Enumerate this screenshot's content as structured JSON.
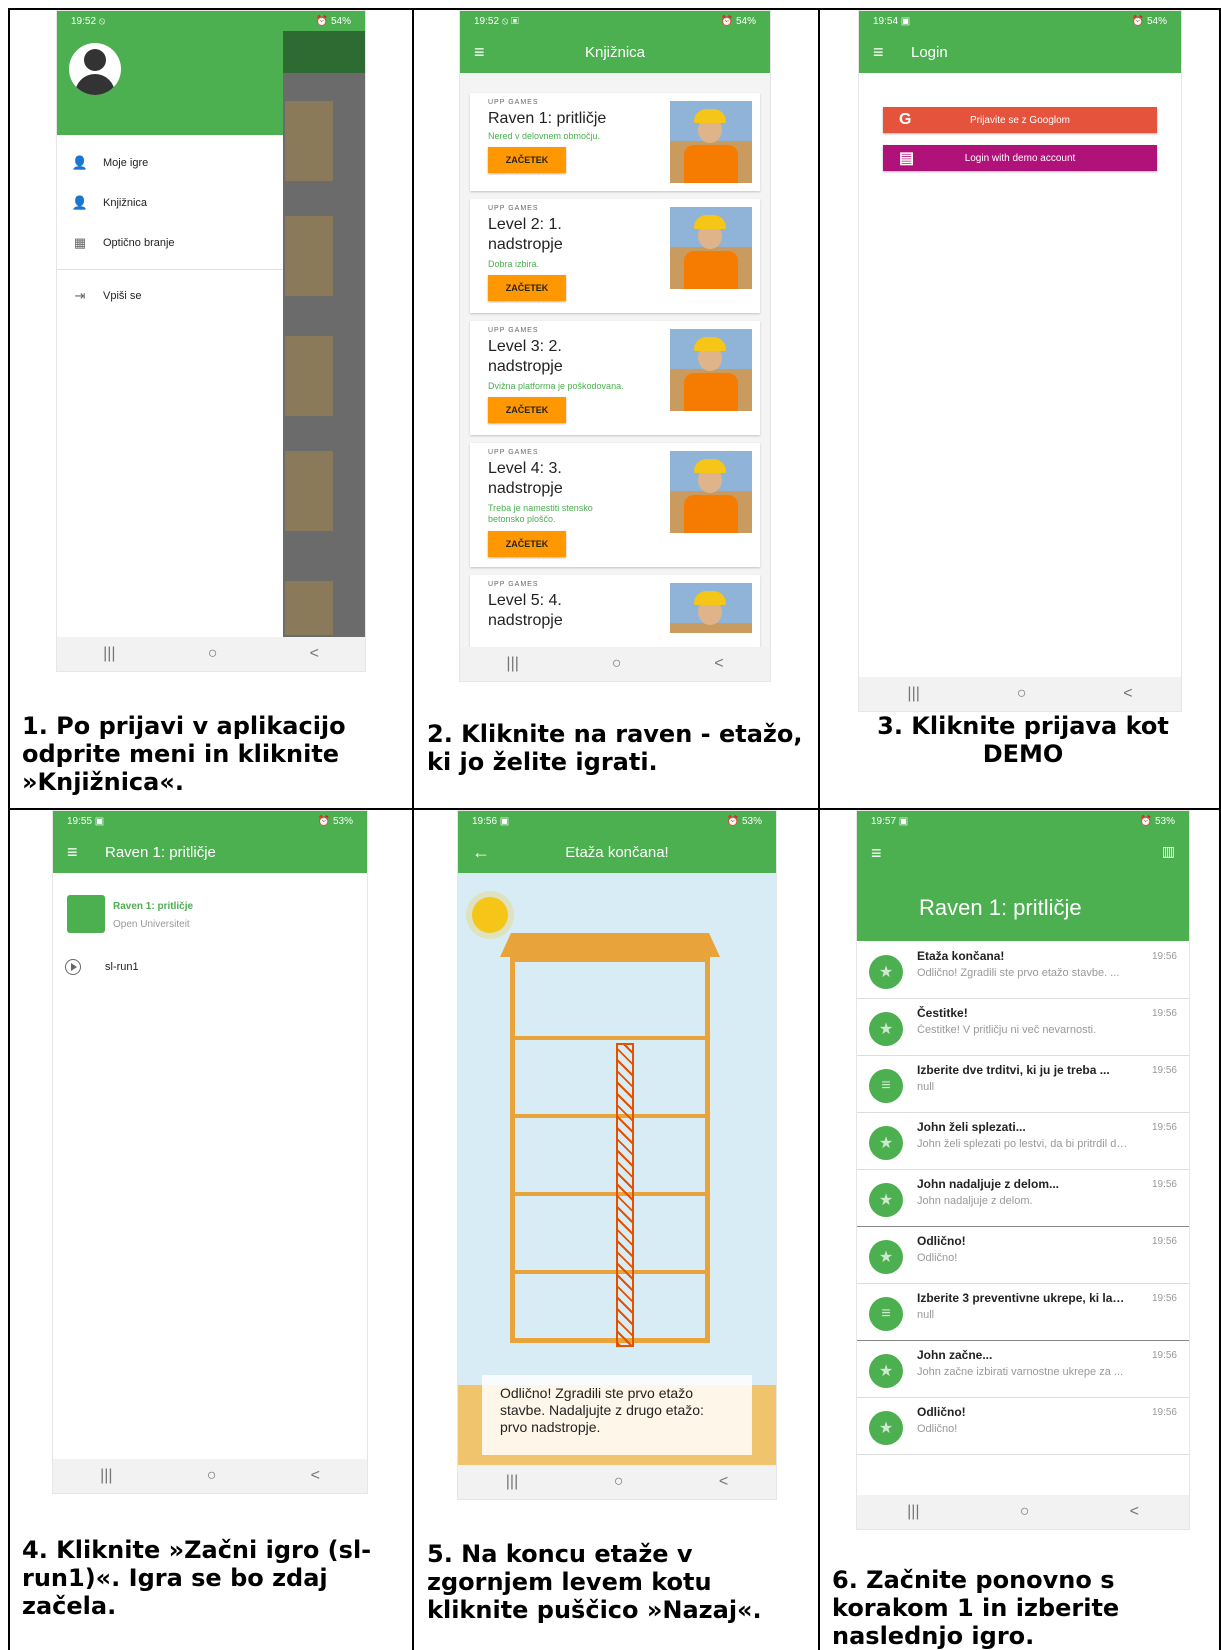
{
  "status": {
    "p1": {
      "time": "19:52 ⦸",
      "right": "⏰ 54%"
    },
    "p2": {
      "time": "19:52 ⦸ ▣",
      "right": "⏰ 54%"
    },
    "p3": {
      "time": "19:54 ▣",
      "right": "⏰ 54%"
    },
    "p4": {
      "time": "19:55 ▣",
      "right": "⏰ 53%"
    },
    "p5": {
      "time": "19:56 ▣",
      "right": "⏰ 53%"
    },
    "p6": {
      "time": "19:57 ▣",
      "right": "⏰ 53%"
    }
  },
  "nav": {
    "recent": "|||",
    "home": "○",
    "back": "<"
  },
  "icons": {
    "menu": "≡",
    "back_arrow": "←",
    "map": "▥",
    "person": "👤",
    "qr": "▦",
    "login": "⇥",
    "star": "★",
    "list": "≡"
  },
  "phone1": {
    "menu": [
      {
        "label": "Moje igre"
      },
      {
        "label": "Knjižnica"
      },
      {
        "label": "Optično branje"
      },
      {
        "label": "Vpiši se"
      }
    ]
  },
  "phone2": {
    "title": "Knjižnica",
    "cards": [
      {
        "brand": "UPP GAMES",
        "name": "Raven 1: pritličje",
        "desc": "Nered v delovnem območju.",
        "button": "ZAČETEK"
      },
      {
        "brand": "UPP GAMES",
        "name": "Level 2: 1. nadstropje",
        "desc": "Dobra izbira.",
        "button": "ZAČETEK"
      },
      {
        "brand": "UPP GAMES",
        "name": "Level 3: 2. nadstropje",
        "desc": "Dvižna platforma je poškodovana.",
        "button": "ZAČETEK"
      },
      {
        "brand": "UPP GAMES",
        "name": "Level 4: 3. nadstropje",
        "desc": "Treba je namestiti stensko betonsko ploščo.",
        "button": "ZAČETEK"
      },
      {
        "brand": "UPP GAMES",
        "name": "Level 5: 4. nadstropje",
        "desc": "",
        "button": ""
      }
    ]
  },
  "phone3": {
    "title": "Login",
    "google_btn": "Prijavite se z Googlom",
    "google_icon": "G",
    "demo_btn": "Login with demo account",
    "demo_icon": "▤"
  },
  "phone4": {
    "title": "Raven 1: pritličje",
    "game_title": "Raven 1: pritličje",
    "game_sub": "Open Universiteit",
    "run": "sl-run1"
  },
  "phone5": {
    "title": "Etaža končana!",
    "message": "Odlično! Zgradili ste prvo etažo stavbe. Nadaljujte z drugo etažo: prvo nadstropje."
  },
  "phone6": {
    "title": "Raven 1: pritličje",
    "items": [
      {
        "title": "Etaža končana!",
        "sub": "Odlično! Zgradili ste prvo etažo stavbe. ...",
        "time": "19:56",
        "icon": "★"
      },
      {
        "title": "Čestitke!",
        "sub": "Čestitke! V pritličju ni več nevarnosti.",
        "time": "19:56",
        "icon": "★"
      },
      {
        "title": "Izberite dve trditvi, ki ju je treba ...",
        "sub": "null",
        "time": "19:56",
        "icon": "≡"
      },
      {
        "title": "John želi splezati...",
        "sub": "John želi splezati po lestvi, da bi pritrdil del ...",
        "time": "19:56",
        "icon": "★"
      },
      {
        "title": "John nadaljuje z delom...",
        "sub": "John nadaljuje z delom.",
        "time": "19:56",
        "icon": "★"
      },
      {
        "title": "Odlično!",
        "sub": "Odlično!",
        "time": "19:56",
        "icon": "★"
      },
      {
        "title": "Izberite 3 preventivne ukrepe, ki lahk...",
        "sub": "null",
        "time": "19:56",
        "icon": "≡"
      },
      {
        "title": "John začne...",
        "sub": "John začne izbirati varnostne ukrepe za ...",
        "time": "19:56",
        "icon": "★"
      },
      {
        "title": "Odlično!",
        "sub": "Odlično!",
        "time": "19:56",
        "icon": "★"
      }
    ]
  },
  "captions": {
    "c1": "1. Po prijavi v aplikacijo odprite meni in kliknite »Knjižnica«.",
    "c2": "2. Kliknite na raven - etažo, ki jo želite igrati.",
    "c3": "3. Kliknite prijava kot DEMO",
    "c4": "4. Kliknite »Začni igro (sl-run1)«. Igra se bo zdaj začela.",
    "c5": "5. Na koncu etaže v zgornjem levem kotu kliknite puščico »Nazaj«.",
    "c6": "6. Začnite ponovno s korakom 1 in izberite naslednjo igro."
  }
}
